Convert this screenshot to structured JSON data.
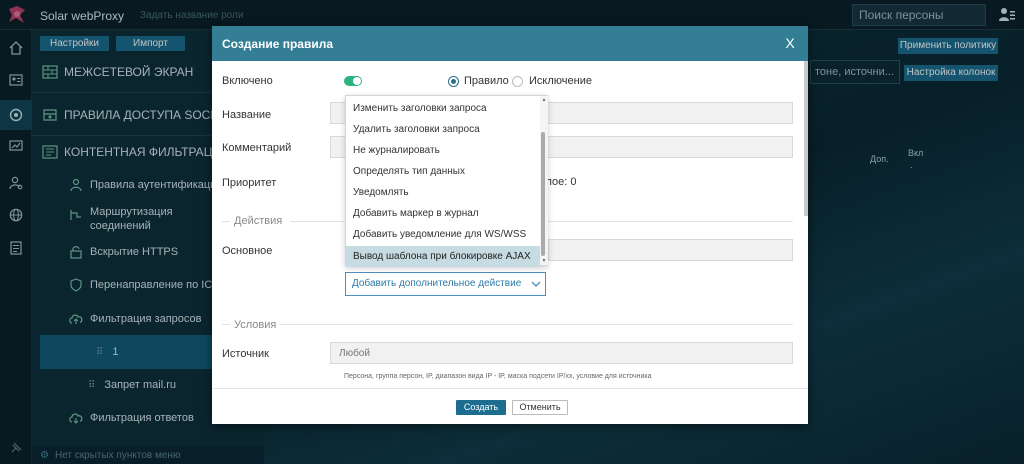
{
  "header": {
    "app_title": "Solar webProxy",
    "rule_name_placeholder": "Задать название роли",
    "search_placeholder": "Поиск персоны"
  },
  "sidebar": {
    "top_buttons": [
      "Настройки",
      "Импорт"
    ],
    "items": [
      {
        "label": "МЕЖСЕТЕВОЙ ЭКРАН",
        "icon": "firewall-icon"
      },
      {
        "label": "ПРАВИЛА ДОСТУПА SOCKS5",
        "icon": "socks-icon"
      },
      {
        "label": "КОНТЕНТНАЯ ФИЛЬТРАЦИЯ",
        "icon": "content-filter-icon"
      },
      {
        "label": "Правила аутентификации",
        "icon": "auth-user-icon"
      },
      {
        "label": "Маршрутизация соединений",
        "icon": "routing-icon"
      },
      {
        "label": "Вскрытие HTTPS",
        "icon": "https-icon"
      },
      {
        "label": "Перенаправление по ICAP",
        "icon": "icap-shield-icon"
      },
      {
        "label": "Фильтрация запросов",
        "icon": "cloud-upload-icon"
      },
      {
        "label": "1",
        "icon": "drag-handle-icon"
      },
      {
        "label": "Запрет mail.ru",
        "icon": "drag-handle-icon"
      },
      {
        "label": "Фильтрация ответов",
        "icon": "cloud-download-icon"
      }
    ],
    "footer": "Нет скрытых пунктов меню"
  },
  "background": {
    "apply_policy": "Применить политику",
    "filter_text": "тоне, источни...",
    "column_settings": "Настройка колонок",
    "col_dop": "Доп.",
    "col_vkl": "Вкл",
    "col_vkl_dot": "."
  },
  "modal": {
    "title": "Создание правила",
    "close": "X",
    "labels": {
      "enabled": "Включено",
      "name": "Название",
      "comment": "Комментарий",
      "priority": "Приоритет",
      "main": "Основное",
      "source": "Источник"
    },
    "radio_rule": "Правило",
    "radio_exception": "Исключение",
    "priority_suffix": "слое: 0",
    "section_actions": "Действия",
    "section_conditions": "Условия",
    "dropdown_options": [
      "Изменить заголовки запроса",
      "Удалить заголовки запроса",
      "Не журналировать",
      "Определять тип данных",
      "Уведомлять",
      "Добавить маркер в журнал",
      "Добавить уведомление для WS/WSS",
      "Вывод шаблона при блокировке AJAX"
    ],
    "dropdown_selected_index": 7,
    "add_action_select": "Добавить дополнительное действие",
    "source_placeholder": "Любой",
    "source_hint": "Персона, группа персон, IP, диапазон вида IP - IP, маска подсети IP/xx, условие для источника",
    "create_button": "Создать",
    "cancel_button": "Отменить"
  },
  "colors": {
    "accent": "#1c6d8f",
    "modal_header": "#337e95",
    "toggle_on": "#2fb380",
    "highlight": "#c6dbe2"
  }
}
